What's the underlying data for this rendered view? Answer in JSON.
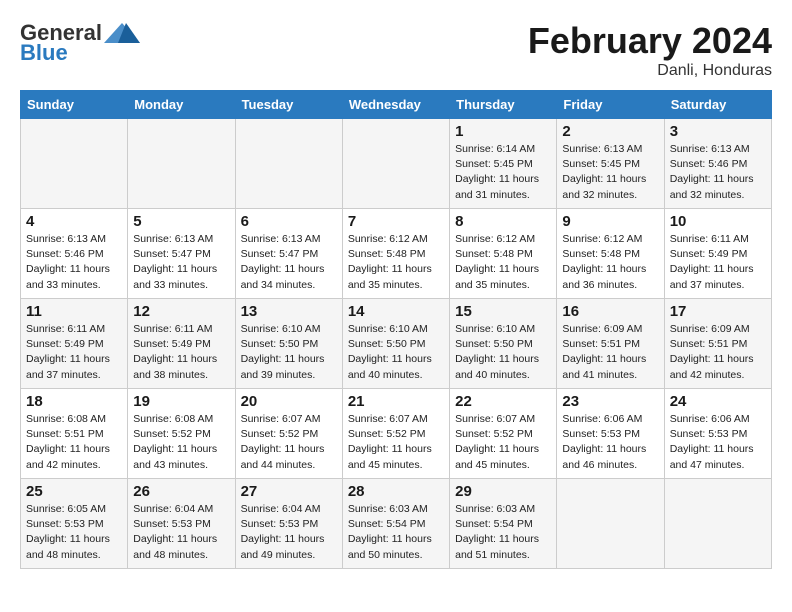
{
  "header": {
    "logo_general": "General",
    "logo_blue": "Blue",
    "month_title": "February 2024",
    "subtitle": "Danli, Honduras"
  },
  "days_of_week": [
    "Sunday",
    "Monday",
    "Tuesday",
    "Wednesday",
    "Thursday",
    "Friday",
    "Saturday"
  ],
  "weeks": [
    [
      {
        "day": "",
        "info": ""
      },
      {
        "day": "",
        "info": ""
      },
      {
        "day": "",
        "info": ""
      },
      {
        "day": "",
        "info": ""
      },
      {
        "day": "1",
        "info": "Sunrise: 6:14 AM\nSunset: 5:45 PM\nDaylight: 11 hours\nand 31 minutes."
      },
      {
        "day": "2",
        "info": "Sunrise: 6:13 AM\nSunset: 5:45 PM\nDaylight: 11 hours\nand 32 minutes."
      },
      {
        "day": "3",
        "info": "Sunrise: 6:13 AM\nSunset: 5:46 PM\nDaylight: 11 hours\nand 32 minutes."
      }
    ],
    [
      {
        "day": "4",
        "info": "Sunrise: 6:13 AM\nSunset: 5:46 PM\nDaylight: 11 hours\nand 33 minutes."
      },
      {
        "day": "5",
        "info": "Sunrise: 6:13 AM\nSunset: 5:47 PM\nDaylight: 11 hours\nand 33 minutes."
      },
      {
        "day": "6",
        "info": "Sunrise: 6:13 AM\nSunset: 5:47 PM\nDaylight: 11 hours\nand 34 minutes."
      },
      {
        "day": "7",
        "info": "Sunrise: 6:12 AM\nSunset: 5:48 PM\nDaylight: 11 hours\nand 35 minutes."
      },
      {
        "day": "8",
        "info": "Sunrise: 6:12 AM\nSunset: 5:48 PM\nDaylight: 11 hours\nand 35 minutes."
      },
      {
        "day": "9",
        "info": "Sunrise: 6:12 AM\nSunset: 5:48 PM\nDaylight: 11 hours\nand 36 minutes."
      },
      {
        "day": "10",
        "info": "Sunrise: 6:11 AM\nSunset: 5:49 PM\nDaylight: 11 hours\nand 37 minutes."
      }
    ],
    [
      {
        "day": "11",
        "info": "Sunrise: 6:11 AM\nSunset: 5:49 PM\nDaylight: 11 hours\nand 37 minutes."
      },
      {
        "day": "12",
        "info": "Sunrise: 6:11 AM\nSunset: 5:49 PM\nDaylight: 11 hours\nand 38 minutes."
      },
      {
        "day": "13",
        "info": "Sunrise: 6:10 AM\nSunset: 5:50 PM\nDaylight: 11 hours\nand 39 minutes."
      },
      {
        "day": "14",
        "info": "Sunrise: 6:10 AM\nSunset: 5:50 PM\nDaylight: 11 hours\nand 40 minutes."
      },
      {
        "day": "15",
        "info": "Sunrise: 6:10 AM\nSunset: 5:50 PM\nDaylight: 11 hours\nand 40 minutes."
      },
      {
        "day": "16",
        "info": "Sunrise: 6:09 AM\nSunset: 5:51 PM\nDaylight: 11 hours\nand 41 minutes."
      },
      {
        "day": "17",
        "info": "Sunrise: 6:09 AM\nSunset: 5:51 PM\nDaylight: 11 hours\nand 42 minutes."
      }
    ],
    [
      {
        "day": "18",
        "info": "Sunrise: 6:08 AM\nSunset: 5:51 PM\nDaylight: 11 hours\nand 42 minutes."
      },
      {
        "day": "19",
        "info": "Sunrise: 6:08 AM\nSunset: 5:52 PM\nDaylight: 11 hours\nand 43 minutes."
      },
      {
        "day": "20",
        "info": "Sunrise: 6:07 AM\nSunset: 5:52 PM\nDaylight: 11 hours\nand 44 minutes."
      },
      {
        "day": "21",
        "info": "Sunrise: 6:07 AM\nSunset: 5:52 PM\nDaylight: 11 hours\nand 45 minutes."
      },
      {
        "day": "22",
        "info": "Sunrise: 6:07 AM\nSunset: 5:52 PM\nDaylight: 11 hours\nand 45 minutes."
      },
      {
        "day": "23",
        "info": "Sunrise: 6:06 AM\nSunset: 5:53 PM\nDaylight: 11 hours\nand 46 minutes."
      },
      {
        "day": "24",
        "info": "Sunrise: 6:06 AM\nSunset: 5:53 PM\nDaylight: 11 hours\nand 47 minutes."
      }
    ],
    [
      {
        "day": "25",
        "info": "Sunrise: 6:05 AM\nSunset: 5:53 PM\nDaylight: 11 hours\nand 48 minutes."
      },
      {
        "day": "26",
        "info": "Sunrise: 6:04 AM\nSunset: 5:53 PM\nDaylight: 11 hours\nand 48 minutes."
      },
      {
        "day": "27",
        "info": "Sunrise: 6:04 AM\nSunset: 5:53 PM\nDaylight: 11 hours\nand 49 minutes."
      },
      {
        "day": "28",
        "info": "Sunrise: 6:03 AM\nSunset: 5:54 PM\nDaylight: 11 hours\nand 50 minutes."
      },
      {
        "day": "29",
        "info": "Sunrise: 6:03 AM\nSunset: 5:54 PM\nDaylight: 11 hours\nand 51 minutes."
      },
      {
        "day": "",
        "info": ""
      },
      {
        "day": "",
        "info": ""
      }
    ]
  ]
}
